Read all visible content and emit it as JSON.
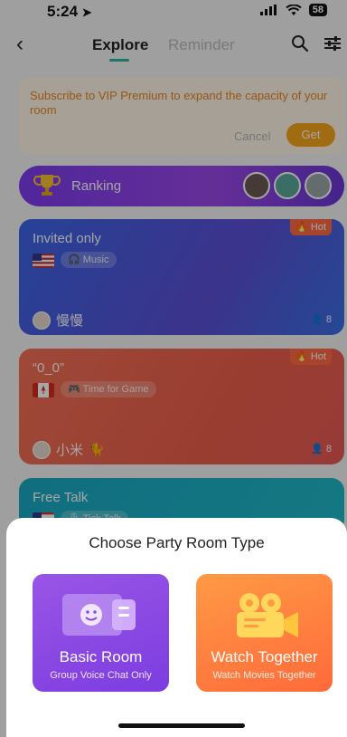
{
  "status": {
    "time": "5:24",
    "battery": "58"
  },
  "nav": {
    "tabs": [
      "Explore",
      "Reminder"
    ],
    "active_tab": "Explore"
  },
  "vip_banner": {
    "text": "Subscribe to VIP Premium to expand the capacity of your room",
    "cancel": "Cancel",
    "get": "Get"
  },
  "ranking": {
    "label": "Ranking"
  },
  "rooms": [
    {
      "title": "Invited only",
      "badge": "Hot",
      "tag": "Music",
      "owner": "慢慢",
      "count": "8"
    },
    {
      "title": "“0_0”",
      "badge": "Hot",
      "tag": "Time for Game",
      "owner": "小米",
      "count": "8"
    },
    {
      "title": "Free Talk",
      "tag": "Tick Talk"
    }
  ],
  "sheet": {
    "title": "Choose Party Room Type",
    "options": [
      {
        "label": "Basic Room",
        "sub": "Group Voice Chat Only"
      },
      {
        "label": "Watch Together",
        "sub": "Watch Movies Together"
      }
    ]
  },
  "colors": {
    "accent_teal": "#2ab59b",
    "vip_orange": "#f7a51b",
    "basic_purple": "#8a48e2",
    "watch_orange": "#ff7a3e"
  }
}
